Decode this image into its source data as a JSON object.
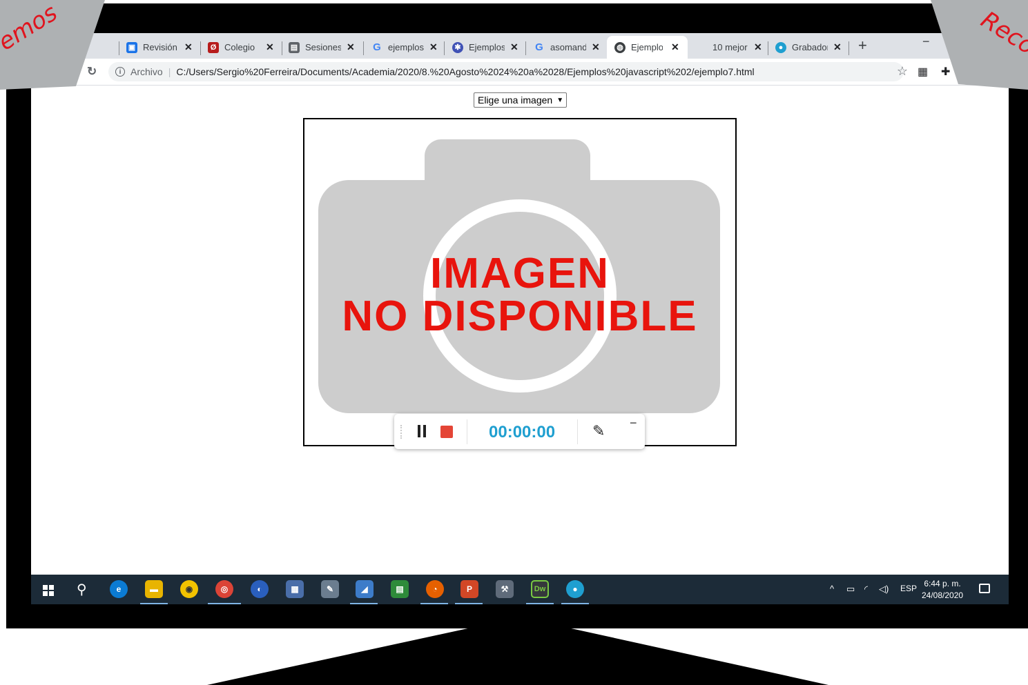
{
  "browser": {
    "tabs": [
      {
        "title": "",
        "icon": "doc-icon",
        "color": "#9aa0a6"
      },
      {
        "title": "Revisión",
        "icon": "classroom-icon",
        "color": "#1a73e8"
      },
      {
        "title": "Colegio",
        "icon": "school-icon",
        "color": "#b71c1c"
      },
      {
        "title": "Sesiones",
        "icon": "sessions-icon",
        "color": "#5f6368"
      },
      {
        "title": "ejemplos",
        "icon": "google-icon",
        "color": "#4285f4"
      },
      {
        "title": "Ejemplos",
        "icon": "settings-icon",
        "color": "#3f51b5"
      },
      {
        "title": "asomand",
        "icon": "google-icon",
        "color": "#4285f4"
      },
      {
        "title": "Ejemplo",
        "icon": "globe-icon",
        "color": "#3c4043"
      },
      {
        "title": "10 mejor",
        "icon": "",
        "color": ""
      },
      {
        "title": "Grabador",
        "icon": "recorder-icon",
        "color": "#1f9fd0"
      }
    ],
    "new_tab_label": "+",
    "minimize_label": "−",
    "address": {
      "scheme": "Archivo",
      "url": "C:/Users/Sergio%20Ferreira/Documents/Academia/2020/8.%20Agosto%2024%20a%2028/Ejemplos%20javascript%202/ejemplo7.html"
    }
  },
  "page": {
    "select": {
      "value": "Elige una imagen"
    },
    "image": {
      "line1": "IMAGEN",
      "line2": "NO DISPONIBLE"
    }
  },
  "recorder": {
    "time": "00:00:00"
  },
  "taskbar": {
    "language": "ESP",
    "time": "6:44 p. m.",
    "date": "24/08/2020",
    "apps": [
      "edge",
      "file-explorer",
      "media",
      "chrome",
      "app",
      "calculator",
      "paint",
      "notes",
      "spreadsheet",
      "firefox",
      "powerpoint",
      "tools",
      "dreamweaver",
      "recorder"
    ]
  },
  "overlay": {
    "left_ribbon": "emos",
    "right_ribbon": "Reco"
  },
  "colors": {
    "accent": "#1f9fd0",
    "stop": "#e44536",
    "headline": "#e8140d",
    "taskbar": "#1c2b38"
  }
}
